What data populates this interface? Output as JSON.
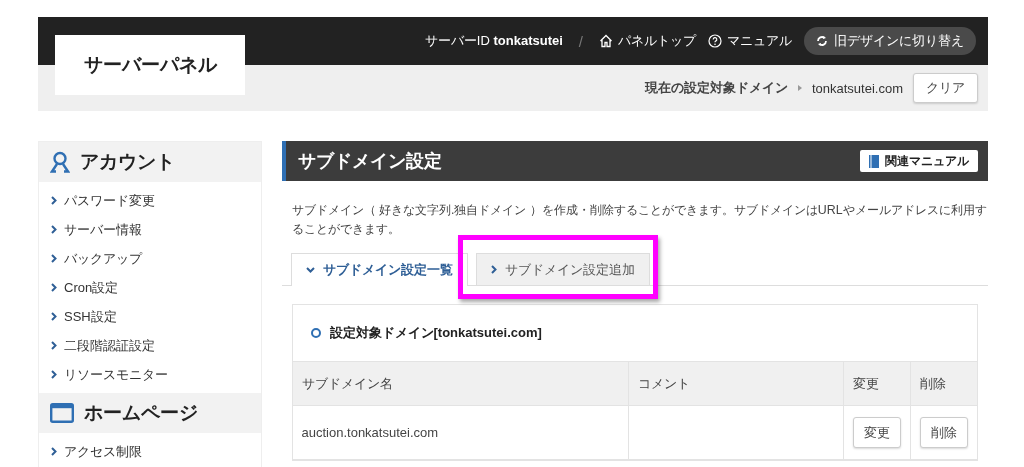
{
  "header": {
    "logo": "サーバーパネル",
    "server_id_label": "サーバーID",
    "server_id": "tonkatsutei",
    "separator": "/",
    "links": [
      {
        "label": "パネルトップ"
      },
      {
        "label": "マニュアル"
      }
    ],
    "switch_button": "旧デザインに切り替え",
    "domain_label": "現在の設定対象ドメイン",
    "domain": "tonkatsutei.com",
    "clear_button": "クリア"
  },
  "sidebar": {
    "sections": [
      {
        "title": "アカウント",
        "items": [
          "パスワード変更",
          "サーバー情報",
          "バックアップ",
          "Cron設定",
          "SSH設定",
          "二段階認証設定",
          "リソースモニター"
        ]
      },
      {
        "title": "ホームページ",
        "items": [
          "アクセス制限"
        ]
      }
    ]
  },
  "main": {
    "title": "サブドメイン設定",
    "manual_button": "関連マニュアル",
    "description": "サブドメイン（ 好きな文字列.独自ドメイン ）を作成・削除することができます。サブドメインはURLやメールアドレスに利用することができます。",
    "tabs": [
      {
        "label": "サブドメイン設定一覧",
        "selected": true,
        "highlighted": false
      },
      {
        "label": "サブドメイン設定追加",
        "selected": false,
        "highlighted": true
      }
    ],
    "domain_heading": "設定対象ドメイン[tonkatsutei.com]",
    "table": {
      "columns": [
        "サブドメイン名",
        "コメント",
        "変更",
        "削除"
      ],
      "rows": [
        {
          "name": "auction.tonkatsutei.com",
          "edit_button": "変更",
          "delete_button": "削除"
        }
      ]
    }
  }
}
